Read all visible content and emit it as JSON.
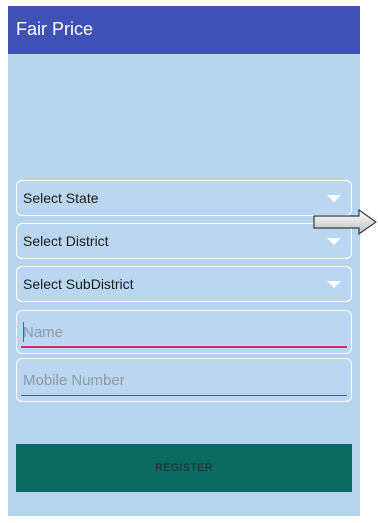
{
  "app": {
    "title": "Fair Price"
  },
  "selects": [
    {
      "label": "Select State"
    },
    {
      "label": "Select District"
    },
    {
      "label": "Select SubDistrict"
    }
  ],
  "inputs": {
    "name_placeholder": "Name",
    "mobile_placeholder": "Mobile Number"
  },
  "register": {
    "label": "REGISTER"
  },
  "colors": {
    "appbar": "#3f51b5",
    "background": "#b7d4ef",
    "register_button": "#0b6b63",
    "focus_accent": "#e91e63"
  },
  "icons": [
    "dropdown-arrow-icon",
    "right-arrow-icon"
  ]
}
